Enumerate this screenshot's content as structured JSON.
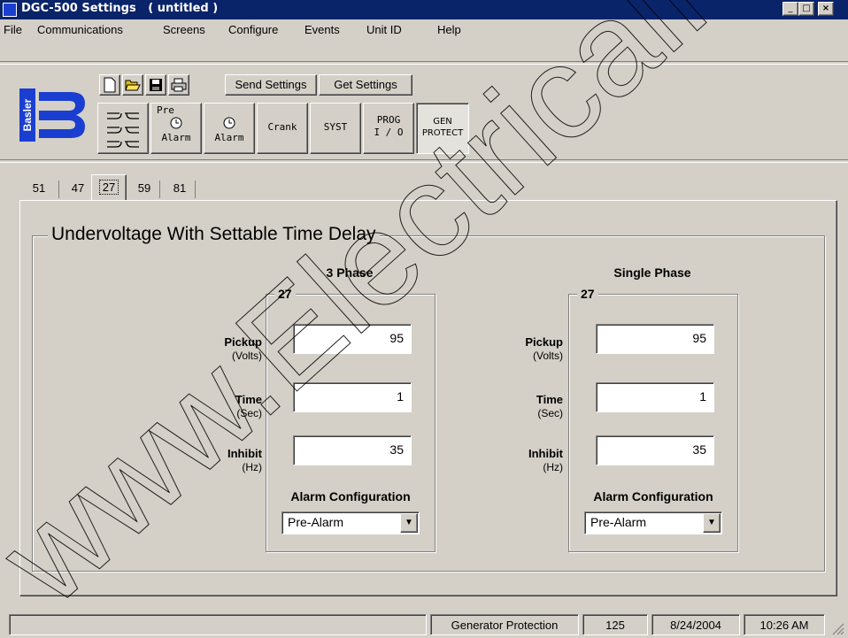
{
  "window": {
    "title": "DGC-500 Settings   ( untitled )"
  },
  "menu": {
    "items": [
      {
        "label": "File"
      },
      {
        "label": "Communications"
      },
      {
        "label": "Screens"
      },
      {
        "label": "Configure"
      },
      {
        "label": "Events"
      },
      {
        "label": "Unit ID"
      },
      {
        "label": "Help"
      }
    ]
  },
  "logo": {
    "text": "Basler"
  },
  "toolbar": {
    "send_settings": "Send Settings",
    "get_settings": "Get Settings",
    "icons": [
      "new-file-icon",
      "open-folder-icon",
      "save-disk-icon",
      "print-icon"
    ]
  },
  "screens": {
    "pre_alarm_top": "Pre",
    "pre_alarm_bottom": "Alarm",
    "alarm": "Alarm",
    "crank": "Crank",
    "syst": "SYST",
    "prog_top": "PROG",
    "prog_bottom": "I / O",
    "gen_top": "GEN",
    "gen_bottom": "PROTECT"
  },
  "tabs": [
    "51",
    "47",
    "27",
    "59",
    "81"
  ],
  "active_tab": "27",
  "section": {
    "title": "Undervoltage With Settable Time Delay"
  },
  "three_phase": {
    "heading": "3 Phase",
    "group": "27",
    "pickup_label": "Pickup",
    "pickup_unit": "(Volts)",
    "pickup_value": "95",
    "time_label": "Time",
    "time_unit": "(Sec)",
    "time_value": "1",
    "inhibit_label": "Inhibit",
    "inhibit_unit": "(Hz)",
    "inhibit_value": "35",
    "alarm_label": "Alarm Configuration",
    "alarm_value": "Pre-Alarm"
  },
  "single_phase": {
    "heading": "Single Phase",
    "group": "27",
    "pickup_label": "Pickup",
    "pickup_unit": "(Volts)",
    "pickup_value": "95",
    "time_label": "Time",
    "time_unit": "(Sec)",
    "time_value": "1",
    "inhibit_label": "Inhibit",
    "inhibit_unit": "(Hz)",
    "inhibit_value": "35",
    "alarm_label": "Alarm Configuration",
    "alarm_value": "Pre-Alarm"
  },
  "status": {
    "screen": "Generator Protection",
    "number": "125",
    "date": "8/24/2004",
    "time": "10:26 AM"
  },
  "watermark": "www.ElectricalPartManuals.com",
  "colors": {
    "titlebar": "#0a246a",
    "logo_blue": "#1a3fd0",
    "face": "#d4d0c8"
  }
}
